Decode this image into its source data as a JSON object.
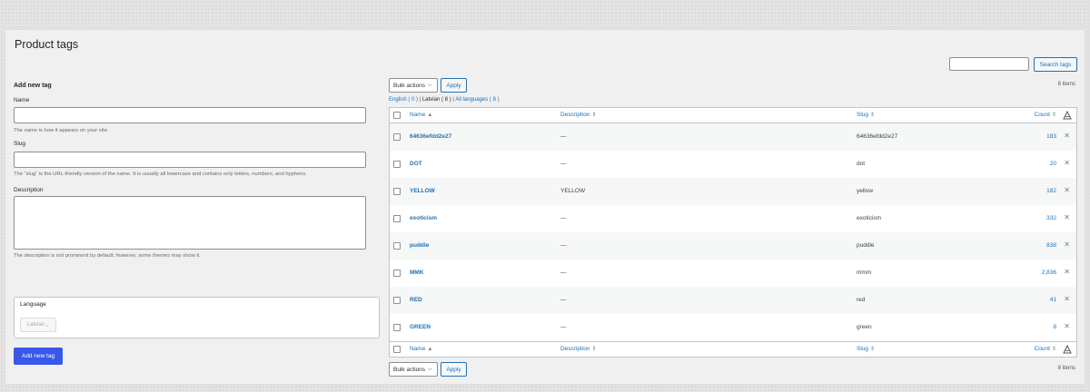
{
  "page": {
    "title": "Product tags"
  },
  "search": {
    "button": "Search tags",
    "value": ""
  },
  "form": {
    "heading": "Add new tag",
    "name_label": "Name",
    "name_hint": "The name is how it appears on your site.",
    "slug_label": "Slug",
    "slug_hint": "The “slug” is the URL-friendly version of the name. It is usually all lowercase and contains only letters, numbers, and hyphens.",
    "desc_label": "Description",
    "desc_hint": "The description is not prominent by default; however, some themes may show it.",
    "language_label": "Language",
    "language_value": "Latvian",
    "submit": "Add new tag"
  },
  "toolbar": {
    "bulk_label": "Bulk actions",
    "apply_label": "Apply",
    "items_count": "8 items"
  },
  "filters": {
    "english": "English",
    "english_count": "( 0 )",
    "latvian": "Latvian",
    "latvian_count": "( 8 )",
    "all": "All languages",
    "all_count": "( 8 )"
  },
  "table": {
    "columns": {
      "name": "Name",
      "description": "Description",
      "slug": "Slug",
      "count": "Count"
    },
    "rows": [
      {
        "name": "64636efdd2e27",
        "description": "—",
        "slug": "64636efdd2e27",
        "count": "183"
      },
      {
        "name": "DOT",
        "description": "—",
        "slug": "dot",
        "count": "20"
      },
      {
        "name": "YELLOW",
        "description": "YELLOW",
        "slug": "yellow",
        "count": "182"
      },
      {
        "name": "exoticism",
        "description": "—",
        "slug": "exoticism",
        "count": "332"
      },
      {
        "name": "puddle",
        "description": "—",
        "slug": "puddle",
        "count": "838"
      },
      {
        "name": "MMK",
        "description": "—",
        "slug": "mmm",
        "count": "2,836"
      },
      {
        "name": "RED",
        "description": "—",
        "slug": "red",
        "count": "41"
      },
      {
        "name": "GREEN",
        "description": "—",
        "slug": "green",
        "count": "8"
      }
    ]
  },
  "icons": {
    "sort": "sort-arrows-icon",
    "delete": "close-icon",
    "translate": "language-icon"
  },
  "colors": {
    "accent": "#2271b1",
    "primary_button": "#3858e9"
  }
}
